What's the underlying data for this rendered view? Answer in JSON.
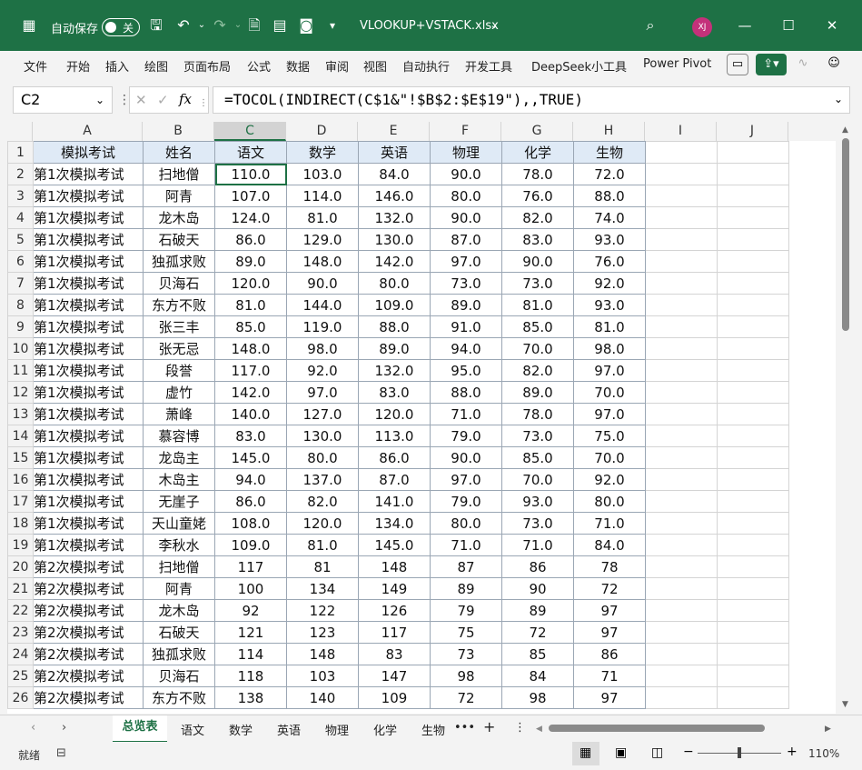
{
  "titlebar": {
    "autosave_label": "自动保存",
    "toggle_state": "关",
    "filename": "VLOOKUP+VSTACK.xlsx",
    "user_initials": "XJ"
  },
  "menu": {
    "items": [
      "文件",
      "开始",
      "插入",
      "绘图",
      "页面布局",
      "公式",
      "数据",
      "审阅",
      "视图",
      "自动执行",
      "开发工具",
      "DeepSeek小工具",
      "Power Pivot"
    ]
  },
  "formula_bar": {
    "name_box": "C2",
    "fx_label": "fx",
    "formula": "=TOCOL(INDIRECT(C$1&\"!$B$2:$E$19\"),,TRUE)"
  },
  "columns": [
    "A",
    "B",
    "C",
    "D",
    "E",
    "F",
    "G",
    "H",
    "I",
    "J"
  ],
  "header_row": [
    "模拟考试",
    "姓名",
    "语文",
    "数学",
    "英语",
    "物理",
    "化学",
    "生物"
  ],
  "rows": [
    [
      "第1次模拟考试",
      "扫地僧",
      "110.0",
      "103.0",
      "84.0",
      "90.0",
      "78.0",
      "72.0"
    ],
    [
      "第1次模拟考试",
      "阿青",
      "107.0",
      "114.0",
      "146.0",
      "80.0",
      "76.0",
      "88.0"
    ],
    [
      "第1次模拟考试",
      "龙木岛",
      "124.0",
      "81.0",
      "132.0",
      "90.0",
      "82.0",
      "74.0"
    ],
    [
      "第1次模拟考试",
      "石破天",
      "86.0",
      "129.0",
      "130.0",
      "87.0",
      "83.0",
      "93.0"
    ],
    [
      "第1次模拟考试",
      "独孤求败",
      "89.0",
      "148.0",
      "142.0",
      "97.0",
      "90.0",
      "76.0"
    ],
    [
      "第1次模拟考试",
      "贝海石",
      "120.0",
      "90.0",
      "80.0",
      "73.0",
      "73.0",
      "92.0"
    ],
    [
      "第1次模拟考试",
      "东方不败",
      "81.0",
      "144.0",
      "109.0",
      "89.0",
      "81.0",
      "93.0"
    ],
    [
      "第1次模拟考试",
      "张三丰",
      "85.0",
      "119.0",
      "88.0",
      "91.0",
      "85.0",
      "81.0"
    ],
    [
      "第1次模拟考试",
      "张无忌",
      "148.0",
      "98.0",
      "89.0",
      "94.0",
      "70.0",
      "98.0"
    ],
    [
      "第1次模拟考试",
      "段誉",
      "117.0",
      "92.0",
      "132.0",
      "95.0",
      "82.0",
      "97.0"
    ],
    [
      "第1次模拟考试",
      "虚竹",
      "142.0",
      "97.0",
      "83.0",
      "88.0",
      "89.0",
      "70.0"
    ],
    [
      "第1次模拟考试",
      "萧峰",
      "140.0",
      "127.0",
      "120.0",
      "71.0",
      "78.0",
      "97.0"
    ],
    [
      "第1次模拟考试",
      "慕容博",
      "83.0",
      "130.0",
      "113.0",
      "79.0",
      "73.0",
      "75.0"
    ],
    [
      "第1次模拟考试",
      "龙岛主",
      "145.0",
      "80.0",
      "86.0",
      "90.0",
      "85.0",
      "70.0"
    ],
    [
      "第1次模拟考试",
      "木岛主",
      "94.0",
      "137.0",
      "87.0",
      "97.0",
      "70.0",
      "92.0"
    ],
    [
      "第1次模拟考试",
      "无崖子",
      "86.0",
      "82.0",
      "141.0",
      "79.0",
      "93.0",
      "80.0"
    ],
    [
      "第1次模拟考试",
      "天山童姥",
      "108.0",
      "120.0",
      "134.0",
      "80.0",
      "73.0",
      "71.0"
    ],
    [
      "第1次模拟考试",
      "李秋水",
      "109.0",
      "81.0",
      "145.0",
      "71.0",
      "71.0",
      "84.0"
    ],
    [
      "第2次模拟考试",
      "扫地僧",
      "117",
      "81",
      "148",
      "87",
      "86",
      "78"
    ],
    [
      "第2次模拟考试",
      "阿青",
      "100",
      "134",
      "149",
      "89",
      "90",
      "72"
    ],
    [
      "第2次模拟考试",
      "龙木岛",
      "92",
      "122",
      "126",
      "79",
      "89",
      "97"
    ],
    [
      "第2次模拟考试",
      "石破天",
      "121",
      "123",
      "117",
      "75",
      "72",
      "97"
    ],
    [
      "第2次模拟考试",
      "独孤求败",
      "114",
      "148",
      "83",
      "73",
      "85",
      "86"
    ],
    [
      "第2次模拟考试",
      "贝海石",
      "118",
      "103",
      "147",
      "98",
      "84",
      "71"
    ],
    [
      "第2次模拟考试",
      "东方不败",
      "138",
      "140",
      "109",
      "72",
      "98",
      "97"
    ]
  ],
  "sheet_tabs": [
    "总览表",
    "语文",
    "数学",
    "英语",
    "物理",
    "化学",
    "生物"
  ],
  "active_tab": "总览表",
  "status": {
    "ready": "就绪",
    "zoom": "110%"
  },
  "colors": {
    "accent": "#1e7145",
    "header_fill": "#dfeaf6"
  }
}
